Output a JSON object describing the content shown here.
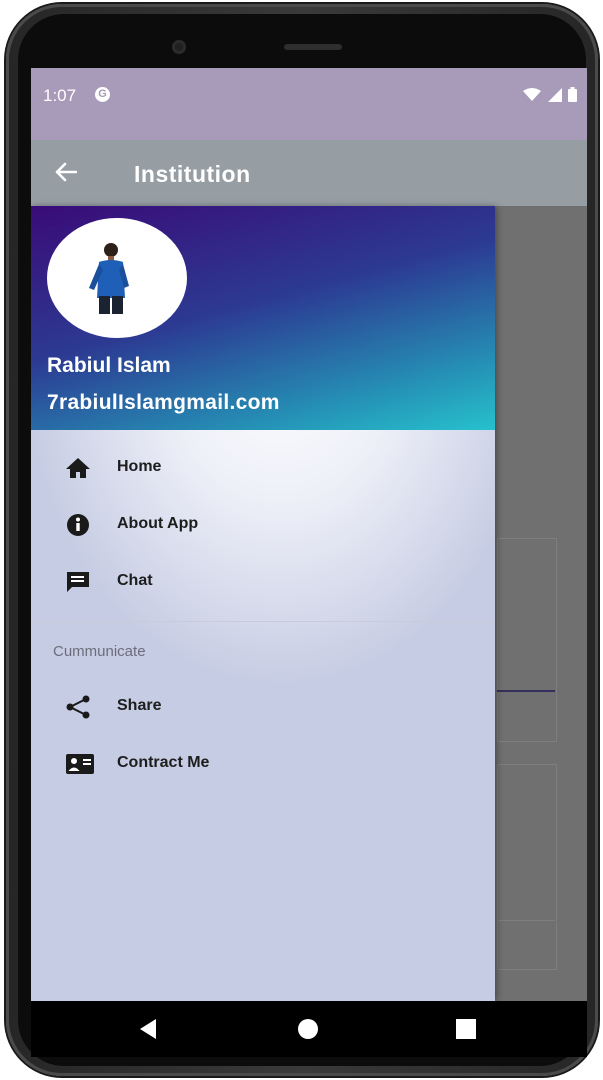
{
  "status_bar": {
    "time": "1:07",
    "notification_badge": "G",
    "icons": [
      "wifi-icon",
      "signal-icon",
      "battery-icon"
    ]
  },
  "app_bar": {
    "title": "Institution",
    "back_icon": "arrow-back-icon",
    "color": "#969ea4"
  },
  "drawer": {
    "profile": {
      "name": "Rabiul Islam",
      "email": "7rabiulIslamgmail.com"
    },
    "primary_items": [
      {
        "label": "Home",
        "icon": "home-icon"
      },
      {
        "label": "About App",
        "icon": "info-icon"
      },
      {
        "label": "Chat",
        "icon": "chat-icon"
      }
    ],
    "section_title": "Cummunicate",
    "secondary_items": [
      {
        "label": "Share",
        "icon": "share-icon"
      },
      {
        "label": "Contract Me",
        "icon": "contact-card-icon"
      }
    ]
  },
  "nav_bar": {
    "buttons": [
      "back-triangle-icon",
      "home-circle-icon",
      "recents-square-icon"
    ]
  },
  "colors": {
    "status_bar": "#a79bb9",
    "header_gradient_start": "#3a0b78",
    "header_gradient_end": "#26c1cd"
  }
}
